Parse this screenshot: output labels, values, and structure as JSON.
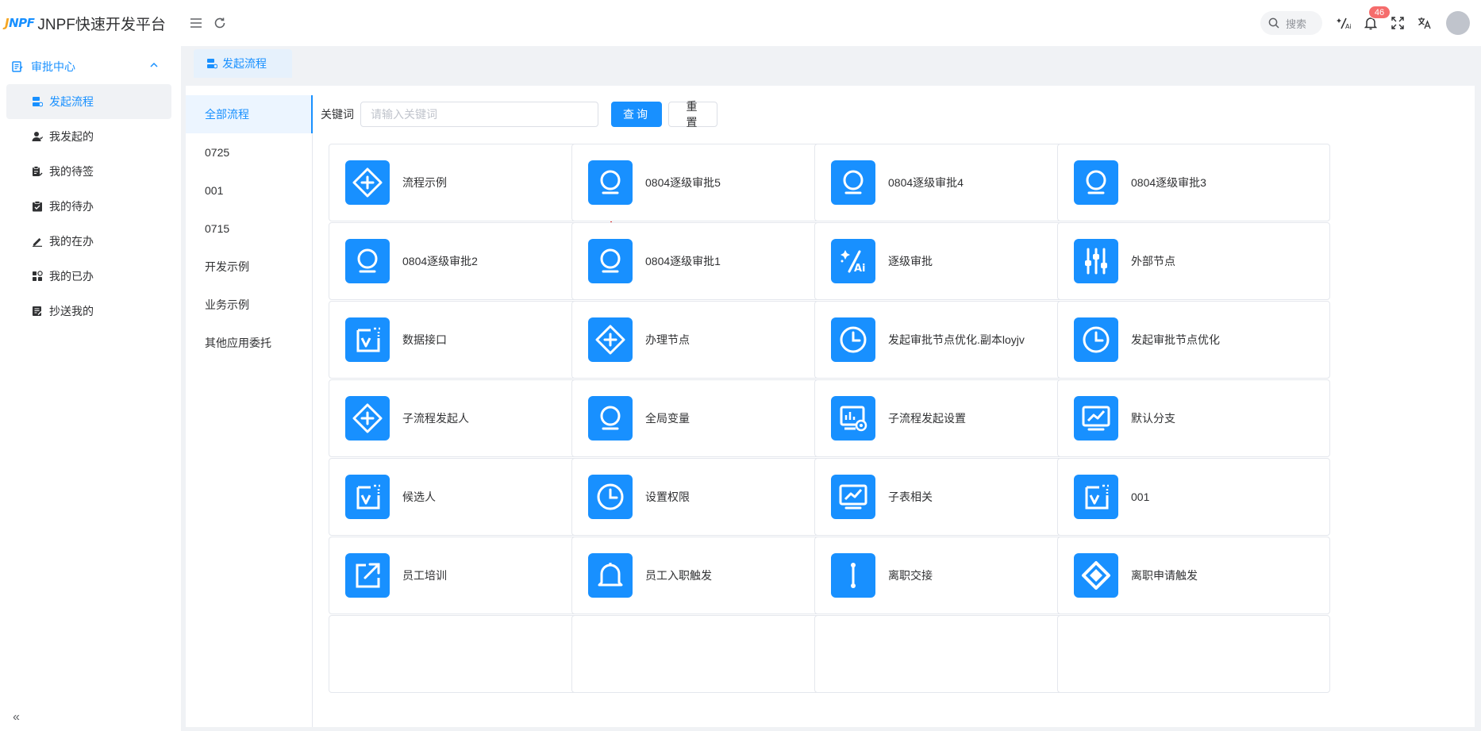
{
  "app": {
    "logo_text": "JNPF",
    "title": "JNPF快速开发平台"
  },
  "header": {
    "search_label": "搜索",
    "notification_count": "46"
  },
  "sidebar": {
    "group_label": "审批中心",
    "items": [
      {
        "label": "发起流程",
        "icon": "launch-process-icon",
        "active": true
      },
      {
        "label": "我发起的",
        "icon": "user-icon"
      },
      {
        "label": "我的待签",
        "icon": "sign-document-icon"
      },
      {
        "label": "我的待办",
        "icon": "todo-clipboard-icon"
      },
      {
        "label": "我的在办",
        "icon": "pen-icon"
      },
      {
        "label": "我的已办",
        "icon": "done-blocks-icon"
      },
      {
        "label": "抄送我的",
        "icon": "cc-document-icon"
      }
    ]
  },
  "tabs": [
    {
      "label": "发起流程",
      "active": true
    }
  ],
  "categories": [
    {
      "label": "全部流程",
      "active": true
    },
    {
      "label": "0725"
    },
    {
      "label": "001"
    },
    {
      "label": "0715"
    },
    {
      "label": "开发示例"
    },
    {
      "label": "业务示例"
    },
    {
      "label": "其他应用委托"
    }
  ],
  "filter": {
    "keyword_label": "关键词",
    "keyword_placeholder": "请输入关键词",
    "keyword_value": "",
    "query_label": "查询",
    "reset_label": "重置"
  },
  "flows": [
    {
      "name": "流程示例",
      "icon": "diamond-plus-icon",
      "selected": true
    },
    {
      "name": "0804逐级审批5",
      "icon": "person-bust-icon"
    },
    {
      "name": "0804逐级审批4",
      "icon": "person-bust-icon"
    },
    {
      "name": "0804逐级审批3",
      "icon": "person-bust-icon"
    },
    {
      "name": "0804逐级审批2",
      "icon": "person-bust-icon"
    },
    {
      "name": "0804逐级审批1",
      "icon": "person-bust-icon"
    },
    {
      "name": "逐级审批",
      "icon": "ai-sparkle-icon"
    },
    {
      "name": "外部节点",
      "icon": "sliders-icon"
    },
    {
      "name": "数据接口",
      "icon": "checkbox-frame-icon"
    },
    {
      "name": "办理节点",
      "icon": "diamond-plus-icon"
    },
    {
      "name": "发起审批节点优化.副本loyjv",
      "icon": "clock-icon"
    },
    {
      "name": "发起审批节点优化",
      "icon": "clock-icon"
    },
    {
      "name": "子流程发起人",
      "icon": "diamond-plus-icon"
    },
    {
      "name": "全局变量",
      "icon": "person-bust-icon"
    },
    {
      "name": "子流程发起设置",
      "icon": "chart-settings-icon"
    },
    {
      "name": "默认分支",
      "icon": "line-chart-monitor-icon"
    },
    {
      "name": "候选人",
      "icon": "checkbox-frame-icon"
    },
    {
      "name": "设置权限",
      "icon": "clock-icon"
    },
    {
      "name": "子表相关",
      "icon": "line-chart-monitor-icon"
    },
    {
      "name": "001",
      "icon": "checkbox-frame-icon"
    },
    {
      "name": "员工培训",
      "icon": "external-link-icon"
    },
    {
      "name": "员工入职触发",
      "icon": "bell-icon"
    },
    {
      "name": "离职交接",
      "icon": "vertical-connector-icon"
    },
    {
      "name": "离职申请触发",
      "icon": "diamond-outline-icon"
    },
    {
      "name": "",
      "icon": ""
    },
    {
      "name": "",
      "icon": ""
    },
    {
      "name": "",
      "icon": ""
    },
    {
      "name": "",
      "icon": ""
    }
  ],
  "colors": {
    "primary": "#1890ff",
    "badge": "#f56c6c",
    "selection_outline": "#e53935"
  }
}
